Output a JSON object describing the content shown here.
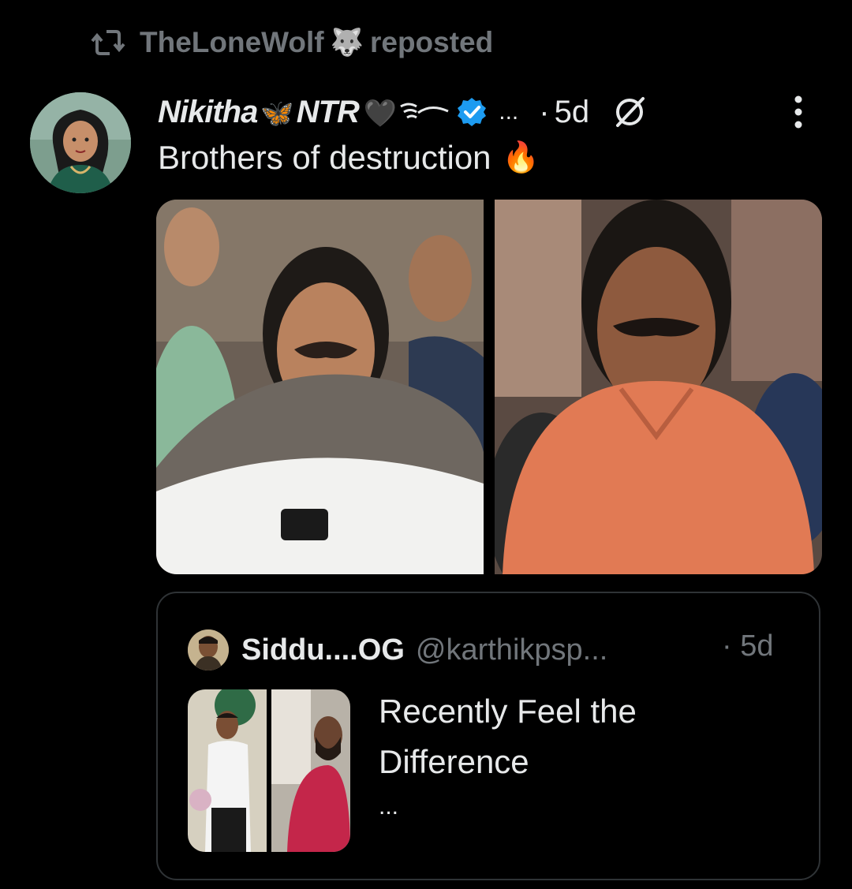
{
  "repost": {
    "user": "TheLoneWolf",
    "user_emoji": "🐺",
    "label": "reposted",
    "icon": "repost-icon"
  },
  "post": {
    "author_name": "Nikitha",
    "author_name_suffix": "NTR",
    "author_emoji_butterfly": "🦋",
    "author_emoji_heart": "🖤",
    "name_ellipsis": "...",
    "time_separator": "·",
    "time": "5d",
    "text": "Brothers of destruction",
    "text_emoji": "🔥",
    "icons": [
      "verified-icon",
      "slash-circle-icon",
      "more-options-icon"
    ]
  },
  "quote": {
    "author_name": "Siddu....OG",
    "handle": "@karthikpsp...",
    "time_separator": "·",
    "time": "5d",
    "text": "Recently Feel the Difference",
    "more": "..."
  },
  "colors": {
    "background": "#000000",
    "text_primary": "#e7e9ea",
    "text_secondary": "#71767b",
    "verified_blue": "#1d9bf0",
    "border": "#2f3336"
  }
}
